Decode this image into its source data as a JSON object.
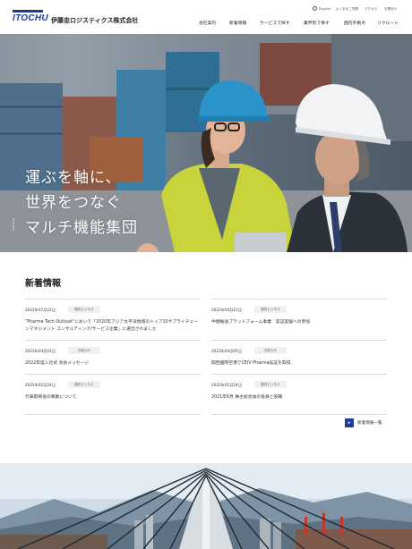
{
  "header": {
    "logo_text": "ITOCHU",
    "company_name": "伊藤忠ロジスティクス株式会社",
    "utility": {
      "language": "English",
      "faq": "よくあるご質問",
      "access": "アクセス",
      "contact": "お問合せ"
    },
    "nav": [
      "会社案内",
      "新着情報",
      "サービスで探す",
      "業界別で探す",
      "国内外拠点",
      "リクルート"
    ]
  },
  "hero": {
    "tagline": [
      "運ぶを軸に、",
      "世界をつなぐ",
      "マルチ機能集団"
    ],
    "scroll_label": "SCROLL"
  },
  "news": {
    "title": "新着情報",
    "items": [
      {
        "date": "2022年07月22日",
        "tag": "国内ビジネス",
        "text": "\"Pharma Tech Outlook\"において「2020年アジア太平洋地域のトップ10サプライチェーンマネジメント コンサルティング/サービス企業」に選出されました"
      },
      {
        "date": "2022年04月12日",
        "tag": "国内ビジネス",
        "text": "中継輸送プラットフォーム事業　実証実験への参加"
      },
      {
        "date": "2022年04月01日",
        "tag": "お知らせ",
        "text": "2022年度入社式 会長メッセージ"
      },
      {
        "date": "2022年04月05日",
        "tag": "お知らせ",
        "text": "関西国際空港でCEIV Pharma認証を取得"
      },
      {
        "date": "2022年02月24日",
        "tag": "国内ビジネス",
        "text": "代表取締役の異動について"
      },
      {
        "date": "2022年02月24日",
        "tag": "国内ビジネス",
        "text": "2021年6月 株主総会後の役員と役職"
      }
    ],
    "more_label": "新着情報一覧",
    "more_icon": "arrow-right-icon"
  },
  "colors": {
    "brand": "#1c3f94",
    "tag_bg": "#eef0f2"
  }
}
